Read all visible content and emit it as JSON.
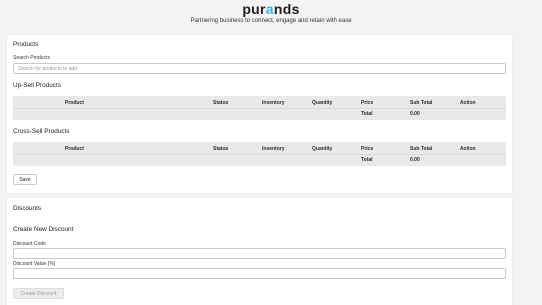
{
  "brand": {
    "logo_prefix": "pur",
    "logo_accent": "a",
    "logo_suffix": "nds",
    "tagline": "Partnering business to connect, engage and retain with ease",
    "accent_color": "#35b5e6"
  },
  "products": {
    "section_title": "Products",
    "search_label": "Search Products",
    "search_placeholder": "Search for products to add",
    "search_value": "",
    "upsell_title": "Up-Sell Products",
    "crosssell_title": "Cross-Sell Products",
    "columns": [
      "Product",
      "Status",
      "Inventory",
      "Quantity",
      "Price",
      "Sub Total",
      "Action"
    ],
    "total_label": "Total",
    "upsell_total": "0.00",
    "crosssell_total": "0.00",
    "save_label": "Save"
  },
  "discounts": {
    "section_title": "Discounts",
    "create_title": "Create New Discount",
    "code_label": "Discount Code",
    "code_value": "",
    "value_label": "Discount Value (%)",
    "value_value": "",
    "create_button_label": "Create Discount"
  }
}
